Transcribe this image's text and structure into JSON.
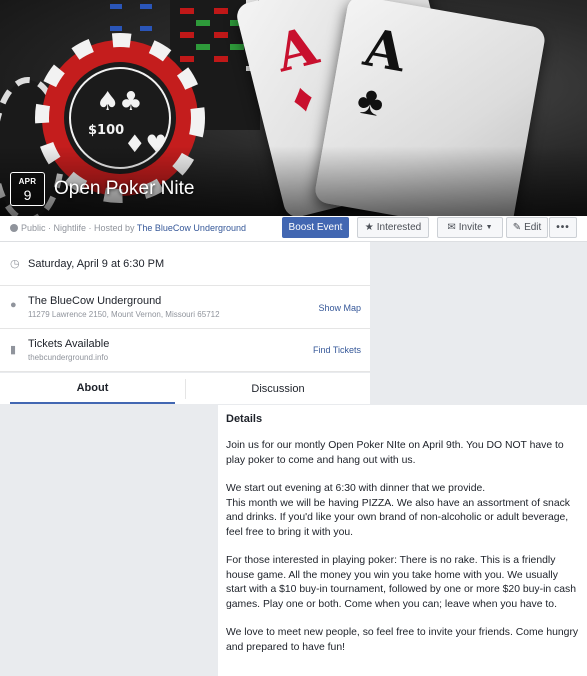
{
  "event": {
    "month": "APR",
    "day": "9",
    "title": "Open Poker Nite"
  },
  "meta": {
    "visibility": "Public",
    "category": "Nightlife",
    "hosted_by_prefix": "Hosted by",
    "host": "The BlueCow Underground"
  },
  "actions": {
    "boost": "Boost Event",
    "interested": "Interested",
    "invite": "Invite",
    "edit": "Edit",
    "more": "•••"
  },
  "info": {
    "date": "Saturday, April 9 at 6:30 PM",
    "location_name": "The BlueCow Underground",
    "location_address": "11279 Lawrence 2150, Mount Vernon, Missouri 65712",
    "show_map": "Show Map",
    "tickets_title": "Tickets Available",
    "tickets_site": "thebcunderground.info",
    "find_tickets": "Find Tickets"
  },
  "tabs": {
    "about": "About",
    "discussion": "Discussion"
  },
  "details": {
    "heading": "Details",
    "p1": "Join us for our montly Open Poker NIte on April 9th. You DO NOT have to play poker to come and hang out with us.",
    "p2a": "We start out evening at 6:30 with dinner that we provide.",
    "p2b": "This month we will be having PIZZA. We also have an assortment of snack and drinks. If you'd like your own brand of non-alcoholic or adult beverage, feel free to bring it with you.",
    "p3": "For those interested in playing poker: There is no rake. This is a friendly house game. All the money you win you take home with you. We usually start with a $10 buy-in tournament, followed by one or more $20 buy-in cash games. Play one or both. Come when you can; leave when you have to.",
    "p4": "We love to meet new people, so feel free to invite your friends. Come hungry and prepared to have fun!"
  },
  "icons": {
    "calendar": "clock-icon",
    "location": "map-pin-icon",
    "tickets": "ticket-icon",
    "interested": "star-icon",
    "invite": "envelope-icon",
    "edit": "pencil-icon"
  },
  "colors": {
    "accent": "#4267b2",
    "link": "#365899"
  }
}
